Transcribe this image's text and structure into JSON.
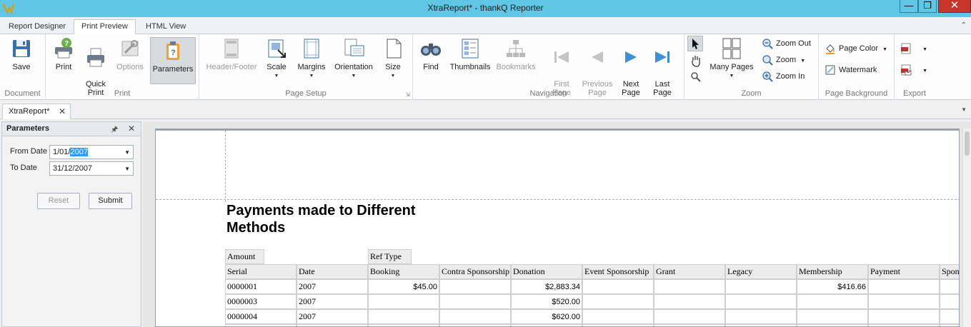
{
  "window": {
    "title": "XtraReport* - thankQ Reporter",
    "min": "—",
    "max": "❐",
    "close": "✕"
  },
  "tabs": [
    {
      "label": "Report Designer"
    },
    {
      "label": "Print Preview"
    },
    {
      "label": "HTML View"
    }
  ],
  "ribbon": {
    "document": {
      "label": "Document",
      "save": "Save"
    },
    "print": {
      "label": "Print",
      "print": "Print",
      "quick_print": "Quick\nPrint",
      "options": "Options",
      "parameters": "Parameters"
    },
    "page_setup": {
      "label": "Page Setup",
      "header_footer": "Header/Footer",
      "scale": "Scale",
      "margins": "Margins",
      "orientation": "Orientation",
      "size": "Size"
    },
    "navigation": {
      "label": "Navigation",
      "find": "Find",
      "thumbnails": "Thumbnails",
      "bookmarks": "Bookmarks",
      "first_page": "First\nPage",
      "previous_page": "Previous\nPage",
      "next_page": "Next\nPage",
      "last_page": "Last\nPage"
    },
    "zoom": {
      "label": "Zoom",
      "many_pages": "Many Pages",
      "zoom_out": "Zoom Out",
      "zoom": "Zoom",
      "zoom_in": "Zoom In"
    },
    "page_background": {
      "label": "Page Background",
      "page_color": "Page Color",
      "watermark": "Watermark"
    },
    "export": {
      "label": "Export"
    }
  },
  "doc_tab": {
    "label": "XtraReport*"
  },
  "parameters": {
    "title": "Parameters",
    "from_label": "From Date",
    "from_value_plain": "1/01/",
    "from_value_selected": "2007",
    "to_label": "To Date",
    "to_value": "31/12/2007",
    "reset": "Reset",
    "submit": "Submit"
  },
  "report": {
    "title": "Payments made to Different Methods",
    "group_headers": [
      "Amount",
      "Ref Type"
    ],
    "columns": [
      "Serial",
      "Date",
      "Booking",
      "Contra Sponsorship",
      "Donation",
      "Event Sponsorship",
      "Grant",
      "Legacy",
      "Membership",
      "Payment",
      "Sponsorship"
    ],
    "rows": [
      [
        "0000001",
        "2007",
        "$45.00",
        "",
        "$2,883.34",
        "",
        "",
        "",
        "$416.66",
        "",
        ""
      ],
      [
        "0000003",
        "2007",
        "",
        "",
        "$520.00",
        "",
        "",
        "",
        "",
        "",
        ""
      ],
      [
        "0000004",
        "2007",
        "",
        "",
        "$620.00",
        "",
        "",
        "",
        "",
        "",
        ""
      ]
    ]
  }
}
